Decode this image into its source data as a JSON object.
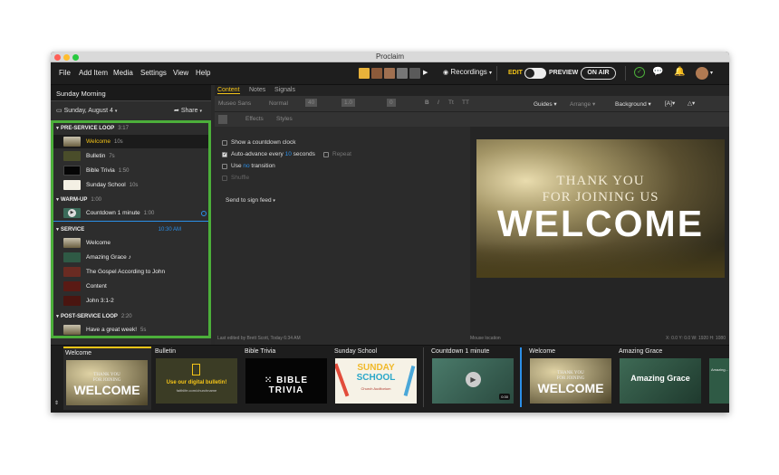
{
  "app": {
    "title": "Proclaim"
  },
  "menu": {
    "file": "File",
    "add_item": "Add Item",
    "media": "Media",
    "settings": "Settings",
    "view": "View",
    "help": "Help"
  },
  "header": {
    "recordings": "Recordings",
    "edit": "EDIT",
    "preview": "PREVIEW",
    "on_air": "ON AIR"
  },
  "service": {
    "name": "Sunday Morning",
    "date": "Sunday, August 4",
    "share": "Share"
  },
  "sections": [
    {
      "name": "PRE-SERVICE LOOP",
      "duration": "3:17",
      "items": [
        {
          "label": "Welcome",
          "duration": "10s"
        },
        {
          "label": "Bulletin",
          "duration": "7s"
        },
        {
          "label": "Bible Trivia",
          "duration": "1:50"
        },
        {
          "label": "Sunday School",
          "duration": "10s"
        }
      ]
    },
    {
      "name": "WARM-UP",
      "duration": "1:00",
      "items": [
        {
          "label": "Countdown 1 minute",
          "duration": "1:00"
        }
      ]
    },
    {
      "name": "SERVICE",
      "duration": "",
      "time": "10:30 AM",
      "items": [
        {
          "label": "Welcome",
          "duration": ""
        },
        {
          "label": "Amazing Grace",
          "duration": ""
        },
        {
          "label": "The Gospel According to John",
          "duration": ""
        },
        {
          "label": "Content",
          "duration": ""
        },
        {
          "label": "John 3:1-2",
          "duration": ""
        }
      ]
    },
    {
      "name": "POST-SERVICE LOOP",
      "duration": "2:20",
      "items": [
        {
          "label": "Have a great week!",
          "duration": "5s"
        }
      ]
    }
  ],
  "tabs": {
    "content": "Content",
    "notes": "Notes",
    "signals": "Signals"
  },
  "toolbar": {
    "font": "Museo Sans",
    "weight": "Normal",
    "size": "40",
    "line": "1.0",
    "spacing": "0",
    "guides": "Guides",
    "arrange": "Arrange",
    "background": "Background",
    "effects": "Effects",
    "styles": "Styles"
  },
  "options": {
    "countdown": "Show a countdown clock",
    "auto_advance": "Auto-advance every",
    "seconds_value": "10",
    "seconds": "seconds",
    "repeat": "Repeat",
    "use": "Use",
    "transition_value": "no",
    "transition": "transition",
    "shuffle": "Shuffle",
    "send_to_feed": "Send to sign feed"
  },
  "preview": {
    "line1": "THANK YOU",
    "line2": "FOR JOINING US",
    "big": "WELCOME"
  },
  "status": {
    "edited": "Last edited by Brett Scott, Today 6:34 AM",
    "mouse": "Mouse location",
    "coords": "X: 0.0 Y: 0.0 W: 1920 H: 1080"
  },
  "strip": [
    {
      "title": "Welcome",
      "kind": "welcome"
    },
    {
      "title": "Bulletin",
      "kind": "bulletin",
      "text": "Use our digital bulletin!",
      "sub": "faithlife.com/churchname"
    },
    {
      "title": "Bible Trivia",
      "kind": "trivia",
      "text": "BIBLE TRIVIA"
    },
    {
      "title": "Sunday School",
      "kind": "school",
      "text1": "SUNDAY",
      "text2": "SCHOOL",
      "sub": "Church Auditorium"
    },
    {
      "title": "Countdown 1 minute",
      "kind": "countdown",
      "badge": "0:30"
    },
    {
      "title": "Welcome",
      "kind": "welcome"
    },
    {
      "title": "Amazing Grace",
      "kind": "grace",
      "text": "Amazing Grace"
    },
    {
      "title": "",
      "kind": "lyrics",
      "text": "Amazing..."
    }
  ],
  "colors": {
    "accent": "#f5c518",
    "green": "#4caf3a",
    "blue": "#2b8fe8"
  }
}
